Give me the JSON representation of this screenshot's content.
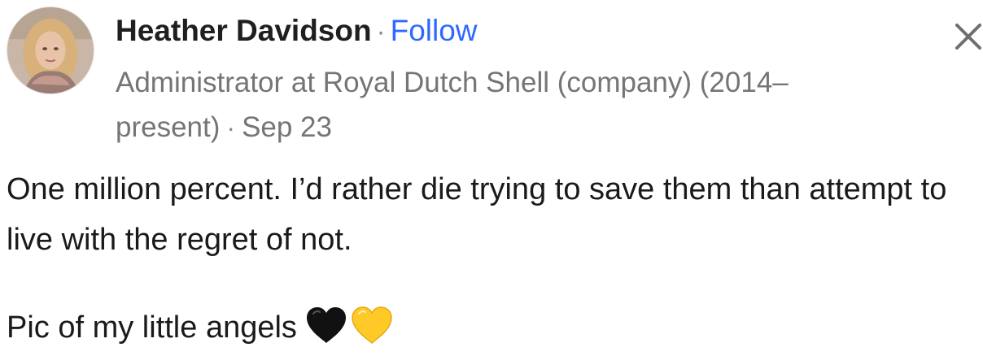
{
  "author": {
    "name": "Heather Davidson",
    "separator": "·",
    "follow_label": "Follow",
    "credential": "Administrator at Royal Dutch Shell (company) (2014–present)",
    "date": "Sep 23"
  },
  "post": {
    "paragraph_1": "One million percent. I’d rather die trying to save them than attempt to live with the regret of not.",
    "paragraph_2": "Pic of my little angels",
    "emojis": [
      "black-heart-icon",
      "yellow-heart-icon"
    ]
  },
  "icons": {
    "close": "close-icon"
  },
  "colors": {
    "follow_link": "#2e69ff",
    "secondary_text": "#757575",
    "primary_text": "#1a1a1a"
  }
}
